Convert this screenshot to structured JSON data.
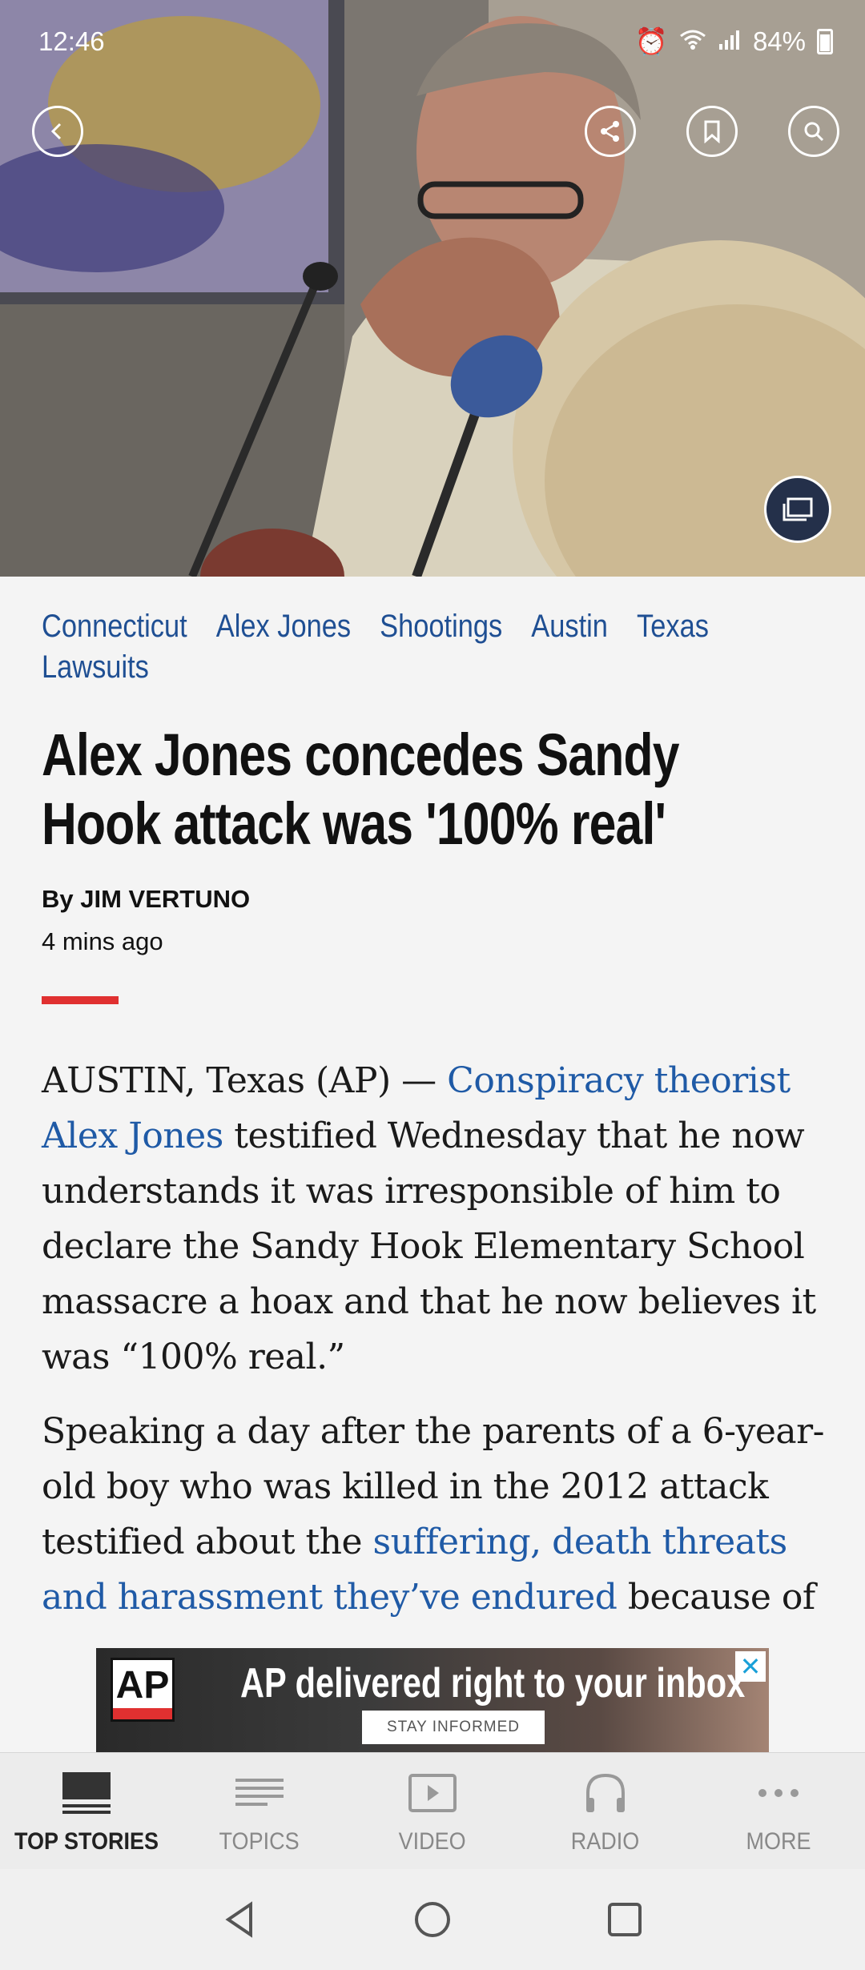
{
  "status_bar": {
    "time": "12:46",
    "battery": "84%"
  },
  "hero": {
    "icons": {
      "back": "back-arrow-icon",
      "share": "share-icon",
      "bookmark": "bookmark-icon",
      "search": "search-icon",
      "gallery": "gallery-icon"
    }
  },
  "article": {
    "tags": [
      "Connecticut",
      "Alex Jones",
      "Shootings",
      "Austin",
      "Texas",
      "Lawsuits"
    ],
    "headline": "Alex Jones concedes Sandy Hook attack was '100% real'",
    "byline": "By JIM VERTUNO",
    "time": "4 mins ago",
    "p1_start": "AUSTIN, Texas (AP) — ",
    "p1_link": "Conspiracy theorist Alex Jones",
    "p1_rest": " testified Wednesday that he now understands it was irresponsible of him to declare the Sandy Hook Elementary School massacre a hoax and that he now believes it was “100% real.”",
    "p2_start": "Speaking a day after the parents of a 6-year-old boy who was killed in the 2012 attack testified about the ",
    "p2_link": "suffering, death threats and harassment they’ve endured",
    "p2_rest": " because of"
  },
  "ad": {
    "logo": "AP",
    "title": "AP delivered right to your inbox",
    "cta": "STAY INFORMED",
    "close": "✕"
  },
  "bottom_nav": {
    "items": [
      {
        "label": "TOP STORIES",
        "icon": "top-stories-icon"
      },
      {
        "label": "TOPICS",
        "icon": "topics-icon"
      },
      {
        "label": "VIDEO",
        "icon": "video-icon"
      },
      {
        "label": "RADIO",
        "icon": "headphones-icon"
      },
      {
        "label": "MORE",
        "icon": "more-dots-icon"
      }
    ]
  },
  "colors": {
    "link": "#1f5aa6",
    "tag": "#1f4f93",
    "accent_red": "#e03030"
  }
}
